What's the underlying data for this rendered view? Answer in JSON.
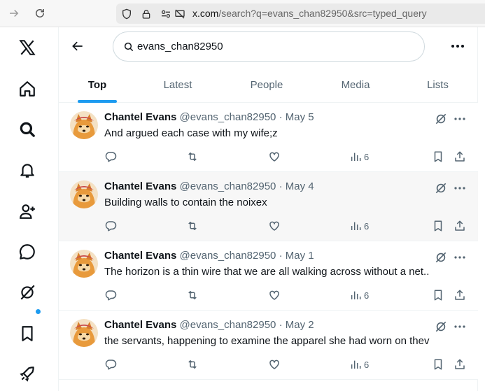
{
  "browser": {
    "url_host": "x.com",
    "url_rest": "/search?q=evans_chan82950&src=typed_query"
  },
  "search": {
    "query": "evans_chan82950"
  },
  "tabs": [
    {
      "label": "Top",
      "active": true
    },
    {
      "label": "Latest",
      "active": false
    },
    {
      "label": "People",
      "active": false
    },
    {
      "label": "Media",
      "active": false
    },
    {
      "label": "Lists",
      "active": false
    }
  ],
  "tweets": [
    {
      "name": "Chantel Evans",
      "handle": "@evans_chan82950",
      "sep": "·",
      "date": "May 5",
      "text": "And argued each case with my wife;z",
      "views": "6"
    },
    {
      "name": "Chantel Evans",
      "handle": "@evans_chan82950",
      "sep": "·",
      "date": "May 4",
      "text": "Building walls to contain the noixex",
      "views": "6"
    },
    {
      "name": "Chantel Evans",
      "handle": "@evans_chan82950",
      "sep": "·",
      "date": "May 1",
      "text": "The horizon is a thin wire that we are all walking across without a net..",
      "views": "6"
    },
    {
      "name": "Chantel Evans",
      "handle": "@evans_chan82950",
      "sep": "·",
      "date": "May 2",
      "text": "the servants, happening to examine the apparel she had worn on thev",
      "views": "6"
    }
  ],
  "colors": {
    "accent": "#1d9bf0",
    "text_primary": "#0f1419",
    "text_secondary": "#536471"
  },
  "icons": {
    "sidebar": [
      "x-logo-icon",
      "home-icon",
      "explore-icon",
      "notifications-icon",
      "follow-icon",
      "messages-icon",
      "grok-icon",
      "bookmarks-icon",
      "premium-rocket-icon"
    ],
    "actions": [
      "reply-icon",
      "repost-icon",
      "like-icon",
      "views-icon",
      "bookmark-icon",
      "share-icon"
    ]
  }
}
